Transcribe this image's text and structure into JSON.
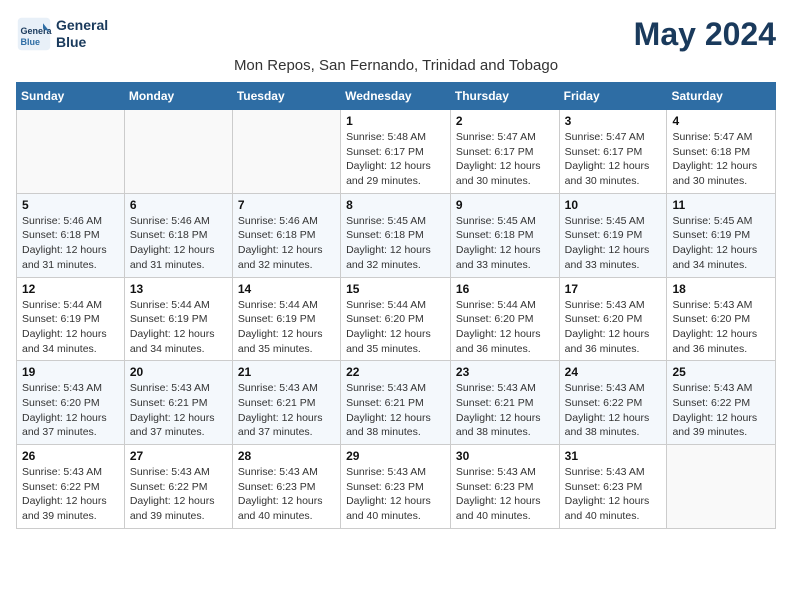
{
  "header": {
    "logo_line1": "General",
    "logo_line2": "Blue",
    "title": "May 2024",
    "subtitle": "Mon Repos, San Fernando, Trinidad and Tobago"
  },
  "weekdays": [
    "Sunday",
    "Monday",
    "Tuesday",
    "Wednesday",
    "Thursday",
    "Friday",
    "Saturday"
  ],
  "weeks": [
    [
      {
        "day": "",
        "info": ""
      },
      {
        "day": "",
        "info": ""
      },
      {
        "day": "",
        "info": ""
      },
      {
        "day": "1",
        "info": "Sunrise: 5:48 AM\nSunset: 6:17 PM\nDaylight: 12 hours\nand 29 minutes."
      },
      {
        "day": "2",
        "info": "Sunrise: 5:47 AM\nSunset: 6:17 PM\nDaylight: 12 hours\nand 30 minutes."
      },
      {
        "day": "3",
        "info": "Sunrise: 5:47 AM\nSunset: 6:17 PM\nDaylight: 12 hours\nand 30 minutes."
      },
      {
        "day": "4",
        "info": "Sunrise: 5:47 AM\nSunset: 6:18 PM\nDaylight: 12 hours\nand 30 minutes."
      }
    ],
    [
      {
        "day": "5",
        "info": "Sunrise: 5:46 AM\nSunset: 6:18 PM\nDaylight: 12 hours\nand 31 minutes."
      },
      {
        "day": "6",
        "info": "Sunrise: 5:46 AM\nSunset: 6:18 PM\nDaylight: 12 hours\nand 31 minutes."
      },
      {
        "day": "7",
        "info": "Sunrise: 5:46 AM\nSunset: 6:18 PM\nDaylight: 12 hours\nand 32 minutes."
      },
      {
        "day": "8",
        "info": "Sunrise: 5:45 AM\nSunset: 6:18 PM\nDaylight: 12 hours\nand 32 minutes."
      },
      {
        "day": "9",
        "info": "Sunrise: 5:45 AM\nSunset: 6:18 PM\nDaylight: 12 hours\nand 33 minutes."
      },
      {
        "day": "10",
        "info": "Sunrise: 5:45 AM\nSunset: 6:19 PM\nDaylight: 12 hours\nand 33 minutes."
      },
      {
        "day": "11",
        "info": "Sunrise: 5:45 AM\nSunset: 6:19 PM\nDaylight: 12 hours\nand 34 minutes."
      }
    ],
    [
      {
        "day": "12",
        "info": "Sunrise: 5:44 AM\nSunset: 6:19 PM\nDaylight: 12 hours\nand 34 minutes."
      },
      {
        "day": "13",
        "info": "Sunrise: 5:44 AM\nSunset: 6:19 PM\nDaylight: 12 hours\nand 34 minutes."
      },
      {
        "day": "14",
        "info": "Sunrise: 5:44 AM\nSunset: 6:19 PM\nDaylight: 12 hours\nand 35 minutes."
      },
      {
        "day": "15",
        "info": "Sunrise: 5:44 AM\nSunset: 6:20 PM\nDaylight: 12 hours\nand 35 minutes."
      },
      {
        "day": "16",
        "info": "Sunrise: 5:44 AM\nSunset: 6:20 PM\nDaylight: 12 hours\nand 36 minutes."
      },
      {
        "day": "17",
        "info": "Sunrise: 5:43 AM\nSunset: 6:20 PM\nDaylight: 12 hours\nand 36 minutes."
      },
      {
        "day": "18",
        "info": "Sunrise: 5:43 AM\nSunset: 6:20 PM\nDaylight: 12 hours\nand 36 minutes."
      }
    ],
    [
      {
        "day": "19",
        "info": "Sunrise: 5:43 AM\nSunset: 6:20 PM\nDaylight: 12 hours\nand 37 minutes."
      },
      {
        "day": "20",
        "info": "Sunrise: 5:43 AM\nSunset: 6:21 PM\nDaylight: 12 hours\nand 37 minutes."
      },
      {
        "day": "21",
        "info": "Sunrise: 5:43 AM\nSunset: 6:21 PM\nDaylight: 12 hours\nand 37 minutes."
      },
      {
        "day": "22",
        "info": "Sunrise: 5:43 AM\nSunset: 6:21 PM\nDaylight: 12 hours\nand 38 minutes."
      },
      {
        "day": "23",
        "info": "Sunrise: 5:43 AM\nSunset: 6:21 PM\nDaylight: 12 hours\nand 38 minutes."
      },
      {
        "day": "24",
        "info": "Sunrise: 5:43 AM\nSunset: 6:22 PM\nDaylight: 12 hours\nand 38 minutes."
      },
      {
        "day": "25",
        "info": "Sunrise: 5:43 AM\nSunset: 6:22 PM\nDaylight: 12 hours\nand 39 minutes."
      }
    ],
    [
      {
        "day": "26",
        "info": "Sunrise: 5:43 AM\nSunset: 6:22 PM\nDaylight: 12 hours\nand 39 minutes."
      },
      {
        "day": "27",
        "info": "Sunrise: 5:43 AM\nSunset: 6:22 PM\nDaylight: 12 hours\nand 39 minutes."
      },
      {
        "day": "28",
        "info": "Sunrise: 5:43 AM\nSunset: 6:23 PM\nDaylight: 12 hours\nand 40 minutes."
      },
      {
        "day": "29",
        "info": "Sunrise: 5:43 AM\nSunset: 6:23 PM\nDaylight: 12 hours\nand 40 minutes."
      },
      {
        "day": "30",
        "info": "Sunrise: 5:43 AM\nSunset: 6:23 PM\nDaylight: 12 hours\nand 40 minutes."
      },
      {
        "day": "31",
        "info": "Sunrise: 5:43 AM\nSunset: 6:23 PM\nDaylight: 12 hours\nand 40 minutes."
      },
      {
        "day": "",
        "info": ""
      }
    ]
  ]
}
